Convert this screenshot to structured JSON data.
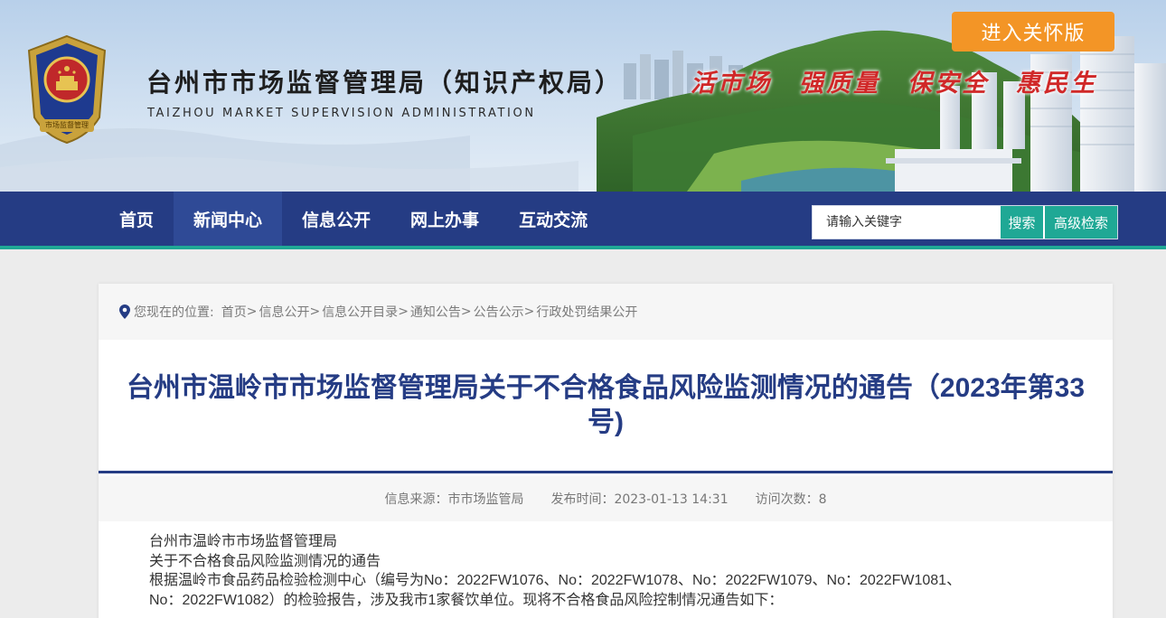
{
  "header": {
    "site_title": "台州市市场监督管理局（知识产权局）",
    "site_subtitle": "TAIZHOU MARKET SUPERVISION ADMINISTRATION",
    "emblem_text": "市场监督管理",
    "slogans": [
      "活市场",
      "强质量",
      "保安全",
      "惠民生"
    ],
    "care_button": "进入关怀版"
  },
  "nav": {
    "items": [
      {
        "label": "首页"
      },
      {
        "label": "新闻中心"
      },
      {
        "label": "信息公开"
      },
      {
        "label": "网上办事"
      },
      {
        "label": "互动交流"
      }
    ],
    "search_placeholder": "请输入关键字",
    "search_button": "搜索",
    "advanced_button": "高级检索"
  },
  "breadcrumb": {
    "prefix": "您现在的位置:",
    "items": [
      "首页",
      "信息公开",
      "信息公开目录",
      "通知公告",
      "公告公示",
      "行政处罚结果公开"
    ],
    "separator": ">"
  },
  "article": {
    "title": "台州市温岭市市场监督管理局关于不合格食品风险监测情况的通告（2023年第33号)",
    "meta": {
      "source": "信息来源：市市场监管局",
      "published": "发布时间：2023-01-13 14:31",
      "visits": "访问次数：8"
    },
    "paragraphs": [
      "台州市温岭市市场监督管理局",
      "关于不合格食品风险监测情况的通告",
      "根据温岭市食品药品检验检测中心（编号为No：2022FW1076、No：2022FW1078、No：2022FW1079、No：2022FW1081、",
      "No：2022FW1082）的检验报告，涉及我市1家餐饮单位。现将不合格食品风险控制情况通告如下："
    ]
  },
  "colors": {
    "nav_bg": "#253c84",
    "accent_teal": "#1fa895",
    "care_orange": "#f39526",
    "slogan_red": "#d02828",
    "title_blue": "#253c84"
  }
}
